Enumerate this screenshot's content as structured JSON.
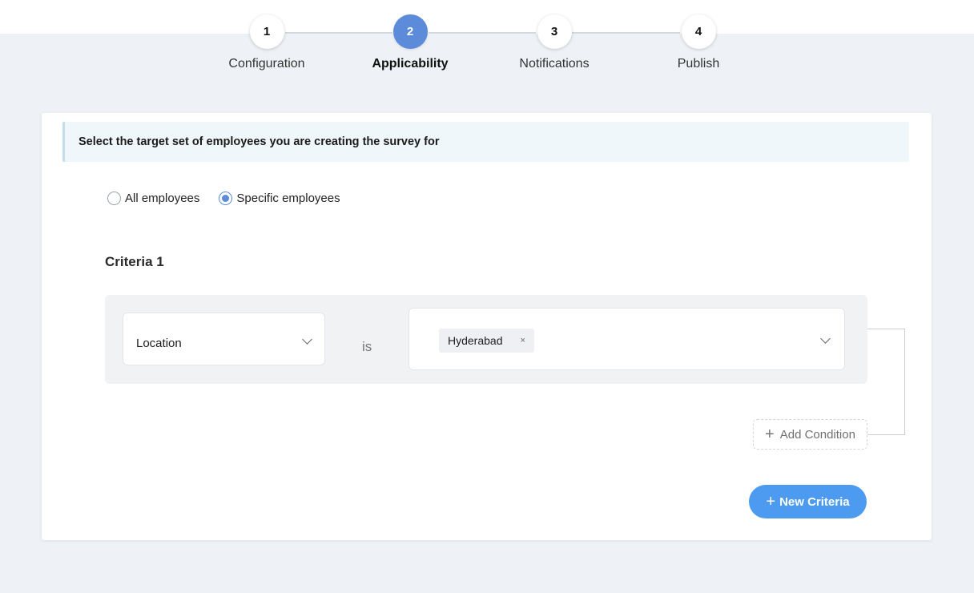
{
  "stepper": {
    "steps": [
      {
        "number": "1",
        "label": "Configuration",
        "active": false
      },
      {
        "number": "2",
        "label": "Applicability",
        "active": true
      },
      {
        "number": "3",
        "label": "Notifications",
        "active": false
      },
      {
        "number": "4",
        "label": "Publish",
        "active": false
      }
    ]
  },
  "info": {
    "text": "Select the target set of employees you are creating the survey for"
  },
  "target": {
    "options": [
      {
        "label": "All employees",
        "checked": false
      },
      {
        "label": "Specific employees",
        "checked": true
      }
    ]
  },
  "criteria": {
    "title": "Criteria 1",
    "field": "Location",
    "operator": "is",
    "values": [
      "Hyderabad"
    ],
    "tag_remove": "×"
  },
  "actions": {
    "add_condition": "Add Condition",
    "new_criteria": "New Criteria",
    "plus": "+"
  },
  "colors": {
    "accent": "#5b8bd9",
    "button": "#4d9bf0",
    "background": "#eef2f6"
  }
}
